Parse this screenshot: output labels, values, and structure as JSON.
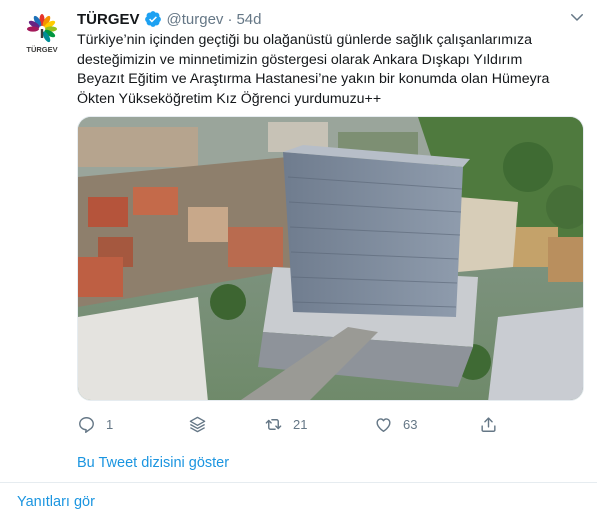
{
  "tweet": {
    "display_name": "TÜRGEV",
    "handle": "@turgev",
    "separator": "·",
    "time": "54d",
    "avatar_logo_text": "TÜRGEV",
    "text": "Türkiye’nin  içinden geçtiği bu olağanüstü günlerde sağlık çalışanlarımıza\ndesteğimizin ve minnetimizin göstergesi olarak Ankara Dışkapı Yıldırım\nBeyazıt Eğitim ve Araştırma Hastanesi’ne yakın bir konumda olan Hümeyra\nÖkten Yükseköğretim Kız Öğrenci yurdumuzu++",
    "actions": {
      "reply_count": "1",
      "retweet_count": "21",
      "like_count": "63"
    },
    "show_thread_label": "Bu Tweet dizisini göster"
  },
  "footer": {
    "see_replies_label": "Yanıtları gör"
  },
  "colors": {
    "link": "#1b95e0",
    "muted": "#657786",
    "verified": "#1da1f2"
  },
  "icons": [
    "turgev-logo",
    "verified-badge-icon",
    "chevron-down-icon",
    "reply-icon",
    "stack-icon",
    "retweet-icon",
    "like-icon",
    "share-icon"
  ]
}
